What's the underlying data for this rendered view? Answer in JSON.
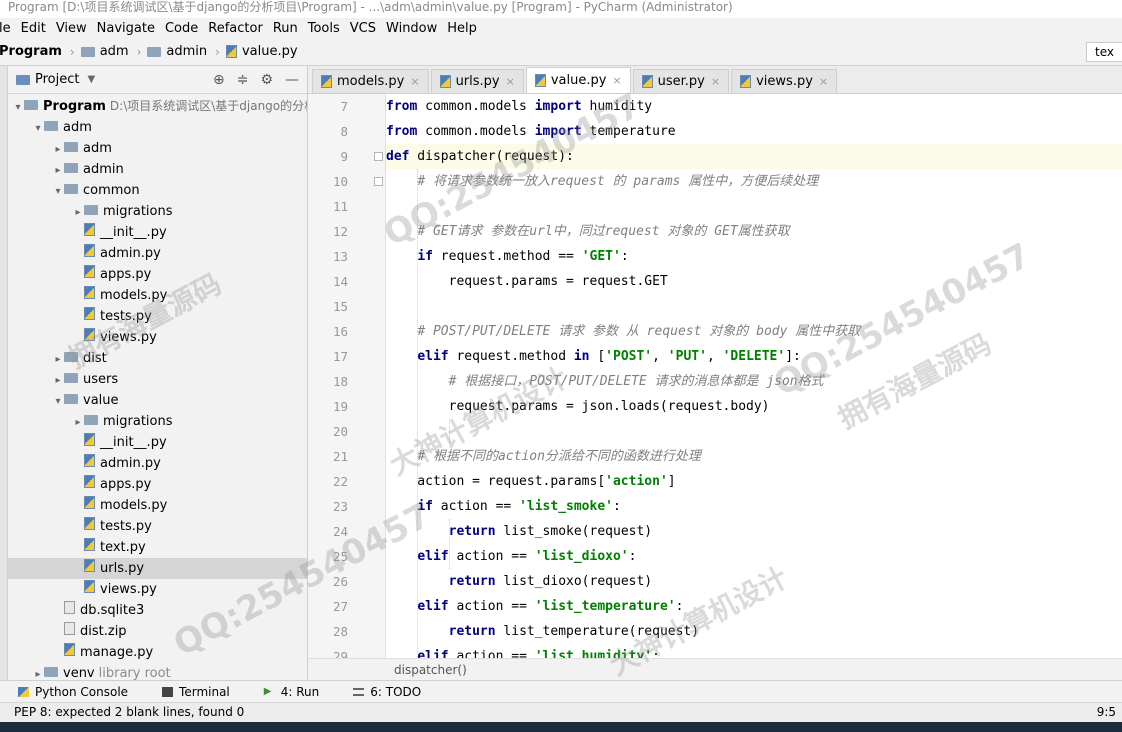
{
  "window": {
    "title": "Program [D:\\项目系统调试区\\基于django的分析项目\\Program] - ...\\adm\\admin\\value.py [Program] - PyCharm (Administrator)"
  },
  "menu": [
    "le",
    "Edit",
    "View",
    "Navigate",
    "Code",
    "Refactor",
    "Run",
    "Tools",
    "VCS",
    "Window",
    "Help"
  ],
  "breadcrumb": [
    "Program",
    "adm",
    "admin",
    "value.py"
  ],
  "right_tab": "tex",
  "project_panel": {
    "header": "Project",
    "root_name": "Program",
    "root_path": "D:\\项目系统调试区\\基于django的分析",
    "tree": [
      {
        "label": "adm",
        "depth": 1,
        "arrow": "▾",
        "type": "folder"
      },
      {
        "label": "adm",
        "depth": 2,
        "arrow": "▸",
        "type": "folder"
      },
      {
        "label": "admin",
        "depth": 2,
        "arrow": "▸",
        "type": "folder"
      },
      {
        "label": "common",
        "depth": 2,
        "arrow": "▾",
        "type": "folder"
      },
      {
        "label": "migrations",
        "depth": 3,
        "arrow": "▸",
        "type": "folder"
      },
      {
        "label": "__init__.py",
        "depth": 3,
        "arrow": "",
        "type": "py"
      },
      {
        "label": "admin.py",
        "depth": 3,
        "arrow": "",
        "type": "py"
      },
      {
        "label": "apps.py",
        "depth": 3,
        "arrow": "",
        "type": "py"
      },
      {
        "label": "models.py",
        "depth": 3,
        "arrow": "",
        "type": "py"
      },
      {
        "label": "tests.py",
        "depth": 3,
        "arrow": "",
        "type": "py"
      },
      {
        "label": "views.py",
        "depth": 3,
        "arrow": "",
        "type": "py"
      },
      {
        "label": "dist",
        "depth": 2,
        "arrow": "▸",
        "type": "folder"
      },
      {
        "label": "users",
        "depth": 2,
        "arrow": "▸",
        "type": "folder"
      },
      {
        "label": "value",
        "depth": 2,
        "arrow": "▾",
        "type": "folder"
      },
      {
        "label": "migrations",
        "depth": 3,
        "arrow": "▸",
        "type": "folder"
      },
      {
        "label": "__init__.py",
        "depth": 3,
        "arrow": "",
        "type": "py"
      },
      {
        "label": "admin.py",
        "depth": 3,
        "arrow": "",
        "type": "py"
      },
      {
        "label": "apps.py",
        "depth": 3,
        "arrow": "",
        "type": "py"
      },
      {
        "label": "models.py",
        "depth": 3,
        "arrow": "",
        "type": "py"
      },
      {
        "label": "tests.py",
        "depth": 3,
        "arrow": "",
        "type": "py"
      },
      {
        "label": "text.py",
        "depth": 3,
        "arrow": "",
        "type": "py"
      },
      {
        "label": "urls.py",
        "depth": 3,
        "arrow": "",
        "type": "py",
        "selected": true
      },
      {
        "label": "views.py",
        "depth": 3,
        "arrow": "",
        "type": "py"
      },
      {
        "label": "db.sqlite3",
        "depth": 2,
        "arrow": "",
        "type": "file"
      },
      {
        "label": "dist.zip",
        "depth": 2,
        "arrow": "",
        "type": "file"
      },
      {
        "label": "manage.py",
        "depth": 2,
        "arrow": "",
        "type": "py"
      },
      {
        "label": "venv",
        "depth": 1,
        "arrow": "▸",
        "type": "folder",
        "extra": "library root"
      }
    ]
  },
  "editor_tabs": [
    {
      "label": "models.py",
      "active": false
    },
    {
      "label": "urls.py",
      "active": false
    },
    {
      "label": "value.py",
      "active": true
    },
    {
      "label": "user.py",
      "active": false
    },
    {
      "label": "views.py",
      "active": false
    }
  ],
  "code_lines": [
    {
      "n": "7",
      "tokens": [
        [
          "kw",
          "from"
        ],
        [
          "",
          " common.models "
        ],
        [
          "kw",
          "import"
        ],
        [
          "",
          " humidity"
        ]
      ]
    },
    {
      "n": "8",
      "tokens": [
        [
          "kw",
          "from"
        ],
        [
          "",
          " common.models "
        ],
        [
          "kw",
          "import"
        ],
        [
          "",
          " temperature"
        ]
      ]
    },
    {
      "n": "9",
      "hl": true,
      "tokens": [
        [
          "kw",
          "def"
        ],
        [
          "",
          " dispatcher(request):"
        ]
      ]
    },
    {
      "n": "10",
      "tokens": [
        [
          "",
          "    "
        ],
        [
          "cmt",
          "# 将请求参数统一放入request 的 params 属性中，方便后续处理"
        ]
      ]
    },
    {
      "n": "11",
      "tokens": []
    },
    {
      "n": "12",
      "tokens": [
        [
          "",
          "    "
        ],
        [
          "cmt",
          "# GET请求 参数在url中，同过request 对象的 GET属性获取"
        ]
      ]
    },
    {
      "n": "13",
      "tokens": [
        [
          "",
          "    "
        ],
        [
          "kw",
          "if"
        ],
        [
          "",
          " request.method == "
        ],
        [
          "str",
          "'GET'"
        ],
        [
          "",
          ":"
        ]
      ]
    },
    {
      "n": "14",
      "tokens": [
        [
          "",
          "        request.params = request.GET"
        ]
      ]
    },
    {
      "n": "15",
      "tokens": []
    },
    {
      "n": "16",
      "tokens": [
        [
          "",
          "    "
        ],
        [
          "cmt",
          "# POST/PUT/DELETE 请求 参数 从 request 对象的 body 属性中获取"
        ]
      ]
    },
    {
      "n": "17",
      "tokens": [
        [
          "",
          "    "
        ],
        [
          "kw",
          "elif"
        ],
        [
          "",
          " request.method "
        ],
        [
          "kw",
          "in"
        ],
        [
          "",
          " ["
        ],
        [
          "str",
          "'POST'"
        ],
        [
          "",
          ", "
        ],
        [
          "str",
          "'PUT'"
        ],
        [
          "",
          ", "
        ],
        [
          "str",
          "'DELETE'"
        ],
        [
          "",
          "]:"
        ]
      ]
    },
    {
      "n": "18",
      "tokens": [
        [
          "",
          "        "
        ],
        [
          "cmt",
          "# 根据接口，POST/PUT/DELETE 请求的消息体都是 json格式"
        ]
      ]
    },
    {
      "n": "19",
      "tokens": [
        [
          "",
          "        request.params = json.loads(request.body)"
        ]
      ]
    },
    {
      "n": "20",
      "tokens": []
    },
    {
      "n": "21",
      "tokens": [
        [
          "",
          "    "
        ],
        [
          "cmt",
          "# 根据不同的action分派给不同的函数进行处理"
        ]
      ]
    },
    {
      "n": "22",
      "tokens": [
        [
          "",
          "    action = request.params["
        ],
        [
          "str",
          "'action'"
        ],
        [
          "",
          "]"
        ]
      ]
    },
    {
      "n": "23",
      "tokens": [
        [
          "",
          "    "
        ],
        [
          "kw",
          "if"
        ],
        [
          "",
          " action == "
        ],
        [
          "str",
          "'list_smoke'"
        ],
        [
          "",
          ":"
        ]
      ]
    },
    {
      "n": "24",
      "tokens": [
        [
          "",
          "        "
        ],
        [
          "kw",
          "return"
        ],
        [
          "",
          " list_smoke(request)"
        ]
      ]
    },
    {
      "n": "25",
      "tokens": [
        [
          "",
          "    "
        ],
        [
          "kw",
          "elif"
        ],
        [
          "",
          " action == "
        ],
        [
          "str",
          "'list_dioxo'"
        ],
        [
          "",
          ":"
        ]
      ]
    },
    {
      "n": "26",
      "tokens": [
        [
          "",
          "        "
        ],
        [
          "kw",
          "return"
        ],
        [
          "",
          " list_dioxo(request)"
        ]
      ]
    },
    {
      "n": "27",
      "tokens": [
        [
          "",
          "    "
        ],
        [
          "kw",
          "elif"
        ],
        [
          "",
          " action == "
        ],
        [
          "str",
          "'list_temperature'"
        ],
        [
          "",
          ":"
        ]
      ]
    },
    {
      "n": "28",
      "tokens": [
        [
          "",
          "        "
        ],
        [
          "kw",
          "return"
        ],
        [
          "",
          " list_temperature(request)"
        ]
      ]
    },
    {
      "n": "29",
      "tokens": [
        [
          "",
          "    "
        ],
        [
          "kw",
          "elif"
        ],
        [
          "",
          " action == "
        ],
        [
          "str",
          "'list_humidity'"
        ],
        [
          "",
          ":"
        ]
      ]
    }
  ],
  "editor_breadcrumb": "dispatcher()",
  "tool_windows": [
    "Python Console",
    "Terminal",
    "4: Run",
    "6: TODO"
  ],
  "status": {
    "message": "PEP 8: expected 2 blank lines, found 0",
    "position": "9:5"
  },
  "watermarks": [
    "QQ:254540457",
    "拥有海量源码",
    "大神计算机设计"
  ]
}
